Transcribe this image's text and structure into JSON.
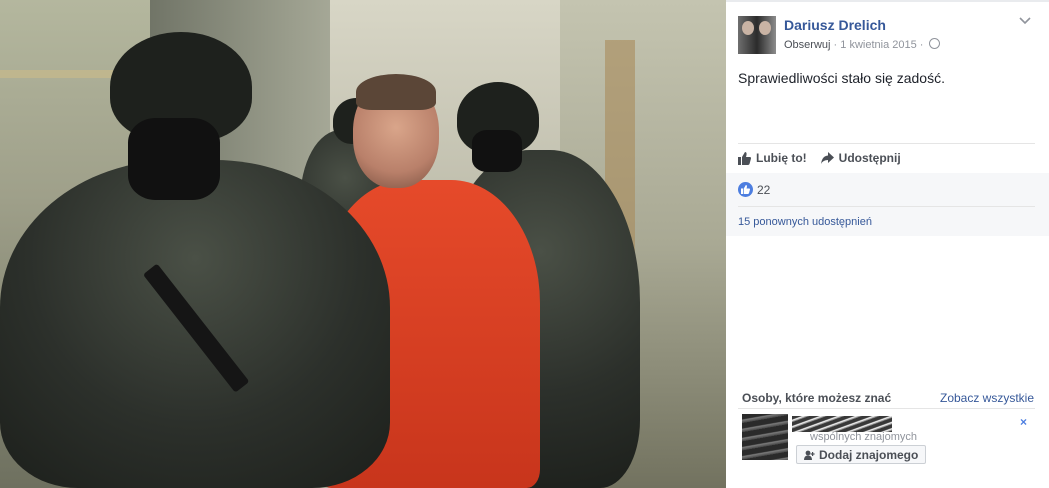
{
  "post": {
    "author": "Dariusz Drelich",
    "follow_label": "Obserwuj",
    "separator": "·",
    "date": "1 kwietnia 2015",
    "text": "Sprawiedliwości stało się zadość."
  },
  "actions": {
    "like_label": "Lubię to!",
    "share_label": "Udostępnij"
  },
  "reactions": {
    "like_count": "22",
    "shares_label": "15 ponownych udostępnień"
  },
  "people_you_may_know": {
    "title": "Osoby, które możesz znać",
    "see_all": "Zobacz wszystkie",
    "mutual_friends": "wspólnych znajomych",
    "add_friend_label": "Dodaj znajomego",
    "close_glyph": "×"
  },
  "icons": {
    "options": "chevron-down-icon",
    "audience": "globe-icon",
    "like": "thumbs-up-icon",
    "share": "share-arrow-icon",
    "add_friend": "add-friend-icon"
  },
  "colors": {
    "link": "#365899",
    "like_badge": "#4d7ee0",
    "prisoner_jumpsuit": "#e64a2a"
  }
}
